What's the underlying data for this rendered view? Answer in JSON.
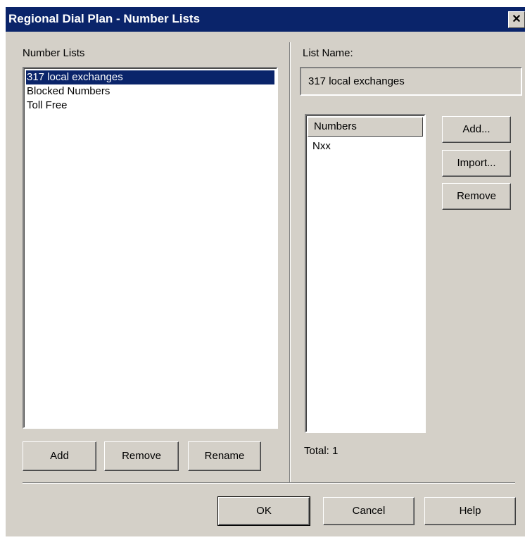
{
  "window": {
    "title": "Regional Dial Plan - Number Lists",
    "close_glyph": "✕"
  },
  "left": {
    "label": "Number Lists",
    "items": [
      "317 local exchanges",
      "Blocked Numbers",
      "Toll Free"
    ],
    "buttons": {
      "add": "Add",
      "remove": "Remove",
      "rename": "Rename"
    }
  },
  "right": {
    "list_name_label": "List Name:",
    "list_name_value": "317 local exchanges",
    "numbers_header": "Numbers",
    "numbers": [
      "Nxx"
    ],
    "total": "Total: 1",
    "buttons": {
      "add": "Add...",
      "import": "Import...",
      "remove": "Remove"
    }
  },
  "footer": {
    "ok": "OK",
    "cancel": "Cancel",
    "help": "Help"
  }
}
